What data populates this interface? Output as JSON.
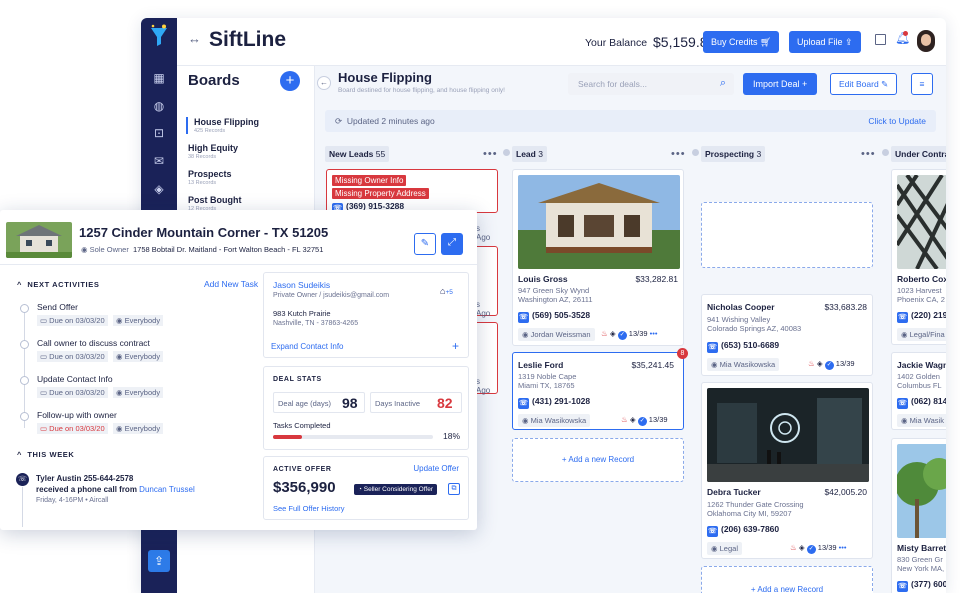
{
  "app": {
    "brand": "SiftLine",
    "balance_label": "Your Balance",
    "balance": "$5,159.89",
    "buy_credits": "Buy Credits",
    "upload_file": "Upload File"
  },
  "boards": {
    "title": "Boards",
    "items": [
      {
        "name": "House Flipping",
        "count": "425 Records",
        "selected": true
      },
      {
        "name": "High Equity",
        "count": "38 Records"
      },
      {
        "name": "Prospects",
        "count": "13 Records"
      },
      {
        "name": "Post Bought",
        "count": "12 Records"
      }
    ]
  },
  "board": {
    "title": "House Flipping",
    "subtitle": "Board destined for house flipping, and house flipping only!",
    "search_placeholder": "Search for deals...",
    "import_deal": "Import Deal",
    "edit_board": "Edit Board",
    "updated": "Updated 2 minutes ago",
    "click_update": "Click to Update"
  },
  "columns": {
    "new_leads": {
      "name": "New Leads",
      "count": "55"
    },
    "lead": {
      "name": "Lead",
      "count": "3"
    },
    "prospecting": {
      "name": "Prospecting",
      "count": "3"
    },
    "under_contract": {
      "name": "Under Contra"
    }
  },
  "new_leads_card": {
    "tag1": "Missing Owner Info",
    "tag2": "Missing Property Address",
    "phone": "(369) 915-3288",
    "ago1": "s Ago",
    "ago2": "s Ago",
    "ago3": "s Ago"
  },
  "lead_cards": [
    {
      "name": "Louis Gross",
      "price": "$33,282.81",
      "addr1": "947 Green Sky Wynd",
      "addr2": "Washington AZ, 26111",
      "phone": "(569) 505-3528",
      "owner": "Jordan Weissman",
      "score": "13/39"
    },
    {
      "name": "Leslie Ford",
      "price": "$35,241.45",
      "addr1": "1319 Noble Cape",
      "addr2": "Miami TX, 18765",
      "phone": "(431) 291-1028",
      "owner": "Mia Wasikowska",
      "score": "13/39",
      "notif": "8"
    }
  ],
  "add_record": "+ Add a new Record",
  "prospect_cards": [
    {
      "name": "Nicholas Cooper",
      "price": "$33,683.28",
      "addr1": "941 Wishing Valley",
      "addr2": "Colorado Springs AZ, 40083",
      "phone": "(653) 510-6689",
      "owner": "Mia Wasikowska",
      "score": "13/39"
    },
    {
      "name": "Debra Tucker",
      "price": "$42,005.20",
      "addr1": "1262 Thunder Gate Crossing",
      "addr2": "Oklahoma City MI, 59207",
      "phone": "(206) 639-7860",
      "owner": "Legal",
      "score": "13/39"
    }
  ],
  "contract_cards": [
    {
      "name": "Roberto Cox",
      "addr1": "1023 Harvest",
      "addr2": "Phoenix CA, 2",
      "phone": "(220) 219",
      "owner": "Legal/Fina"
    },
    {
      "name": "Jackie Wagn",
      "addr1": "1402 Golden",
      "addr2": "Columbus FL",
      "phone": "(062) 814",
      "owner": "Mia Wasik"
    },
    {
      "name": "Misty Barrett",
      "addr1": "830 Green Gr",
      "addr2": "New York MA,",
      "phone": "(377) 600"
    }
  ],
  "detail": {
    "title": "1257 Cinder Mountain Corner - TX 51205",
    "owner_badge": "Sole Owner",
    "address": "1758 Bobtail Dr. Maitland - Fort Walton Beach - FL 32751",
    "next_activities": "NEXT ACTIVITIES",
    "add_task": "Add New Task",
    "activities": [
      {
        "title": "Send Offer",
        "due": "Due on 03/03/20",
        "who": "Everybody",
        "late": false
      },
      {
        "title": "Call owner to discuss contract",
        "due": "Due on 03/03/20",
        "who": "Everybody",
        "late": false
      },
      {
        "title": "Update Contact Info",
        "due": "Due on 03/03/20",
        "who": "Everybody",
        "late": false
      },
      {
        "title": "Follow-up with owner",
        "due": "Due on 03/03/20",
        "who": "Everybody",
        "late": true
      }
    ],
    "this_week": "THIS WEEK",
    "event_line1": "Tyler Austin 255-644-2578",
    "event_line2a": "received a phone call from",
    "event_line2b": "Duncan Trussel",
    "event_time": "Friday, 4-16PM • Aircall",
    "contact": {
      "name": "Jason Sudeikis",
      "role": "Private Owner / jsudeikis@gmail.com",
      "plus": "+5",
      "addr1": "983 Kutch Prairie",
      "addr2": "Nashville, TN - 37863-4265",
      "expand": "Expand Contact Info"
    },
    "stats": {
      "title": "DEAL STATS",
      "age_label": "Deal age (days)",
      "age": "98",
      "inactive_label": "Days Inactive",
      "inactive": "82",
      "tasks_label": "Tasks Completed",
      "tasks_pct": "18%",
      "tasks_fraction": 0.18
    },
    "offer": {
      "title": "ACTIVE OFFER",
      "update": "Update Offer",
      "amount": "$356,990",
      "status": "Seller Considering Offer",
      "history": "See Full Offer History"
    }
  },
  "colors": {
    "primary": "#2d6cf0",
    "nav": "#1a2258",
    "danger": "#d8383e"
  }
}
